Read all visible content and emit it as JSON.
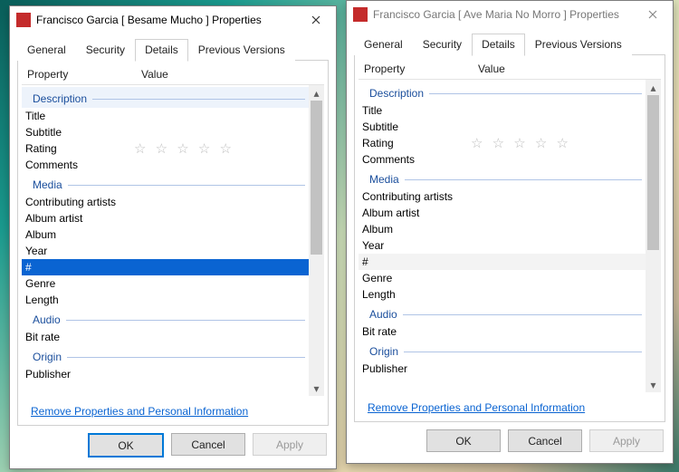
{
  "tabs": {
    "general": "General",
    "security": "Security",
    "details": "Details",
    "previous": "Previous Versions"
  },
  "headers": {
    "property": "Property",
    "value": "Value"
  },
  "sections": {
    "description": "Description",
    "media": "Media",
    "audio": "Audio",
    "origin": "Origin"
  },
  "props": {
    "title": "Title",
    "subtitle": "Subtitle",
    "rating": "Rating",
    "comments": "Comments",
    "contributing": "Contributing artists",
    "albumartist": "Album artist",
    "album": "Album",
    "year": "Year",
    "track": "#",
    "genre": "Genre",
    "length": "Length",
    "bitrate": "Bit rate",
    "publisher": "Publisher"
  },
  "stars": "☆ ☆ ☆ ☆ ☆",
  "link": "Remove Properties and Personal Information",
  "buttons": {
    "ok": "OK",
    "cancel": "Cancel",
    "apply": "Apply"
  },
  "dialogs": [
    {
      "title": "Francisco Garcia [ Besame Mucho ] Properties"
    },
    {
      "title": "Francisco Garcia [ Ave Maria No Morro ] Properties"
    }
  ]
}
